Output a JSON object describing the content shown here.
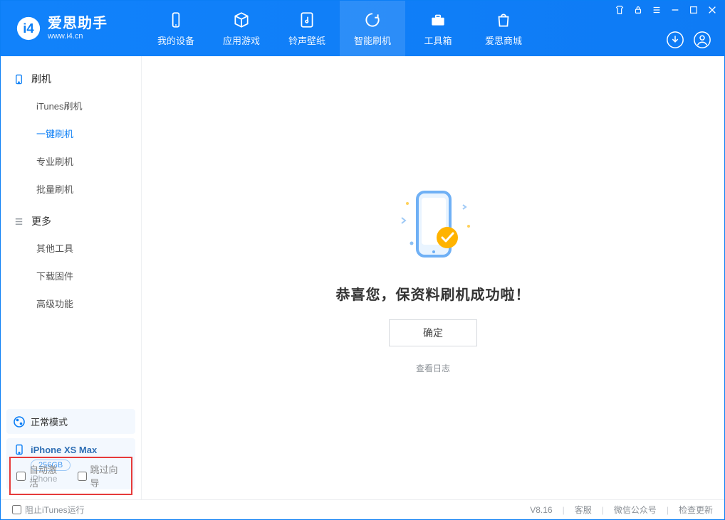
{
  "header": {
    "app_name": "爱思助手",
    "app_url": "www.i4.cn",
    "nav": [
      "我的设备",
      "应用游戏",
      "铃声壁纸",
      "智能刷机",
      "工具箱",
      "爱思商城"
    ],
    "active_nav_index": 3
  },
  "sidebar": {
    "groups": [
      {
        "title": "刷机",
        "items": [
          "iTunes刷机",
          "一键刷机",
          "专业刷机",
          "批量刷机"
        ],
        "active_index": 1
      },
      {
        "title": "更多",
        "items": [
          "其他工具",
          "下载固件",
          "高级功能"
        ],
        "active_index": -1
      }
    ],
    "mode_card": "正常模式",
    "device": {
      "name": "iPhone XS Max",
      "storage": "256GB",
      "os": "iPhone"
    },
    "options": {
      "auto_activate": "自动激活",
      "skip_wizard": "跳过向导"
    }
  },
  "content": {
    "success_title": "恭喜您，保资料刷机成功啦！",
    "ok_label": "确定",
    "view_log": "查看日志"
  },
  "footer": {
    "block_itunes": "阻止iTunes运行",
    "version": "V8.16",
    "links": [
      "客服",
      "微信公众号",
      "检查更新"
    ]
  },
  "colors": {
    "brand": "#0b7ef5",
    "accent": "#ffb300"
  }
}
